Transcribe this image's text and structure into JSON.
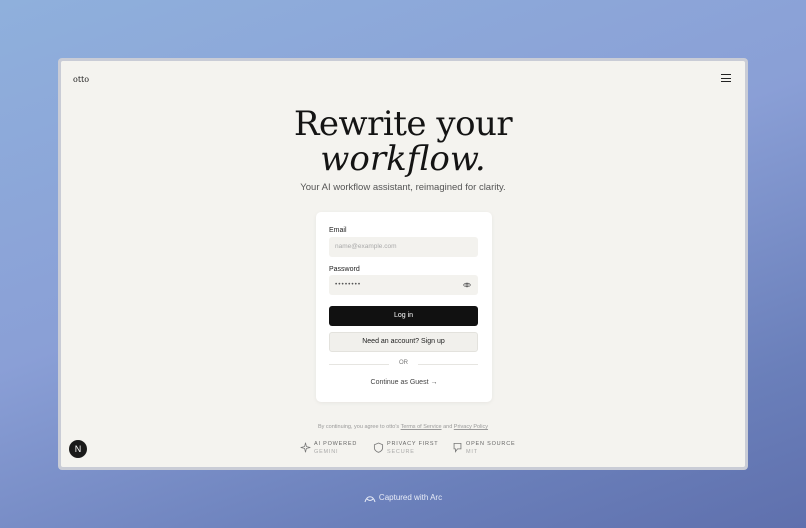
{
  "header": {
    "logo": "otto",
    "menu_icon": "menu-icon"
  },
  "hero": {
    "line1": "Rewrite your",
    "line2": "workflow.",
    "subtitle": "Your AI workflow assistant, reimagined for clarity."
  },
  "login": {
    "email_label": "Email",
    "email_placeholder": "name@example.com",
    "password_label": "Password",
    "password_value": "••••••••",
    "login_button": "Log in",
    "signup_button": "Need an account? Sign up",
    "divider": "OR",
    "guest_link": "Continue as Guest →"
  },
  "terms": {
    "prefix": "By continuing, you agree to otto's",
    "terms_link": "Terms of Service",
    "and": "and",
    "privacy_link": "Privacy Policy"
  },
  "features": [
    {
      "title": "AI POWERED",
      "sub": "GEMINI",
      "icon": "sparkle-icon"
    },
    {
      "title": "PRIVACY FIRST",
      "sub": "SECURE",
      "icon": "shield-icon"
    },
    {
      "title": "OPEN SOURCE",
      "sub": "MIT",
      "icon": "code-icon"
    }
  ],
  "badge": {
    "letter": "N"
  },
  "footer": {
    "caption": "Captured with Arc"
  }
}
